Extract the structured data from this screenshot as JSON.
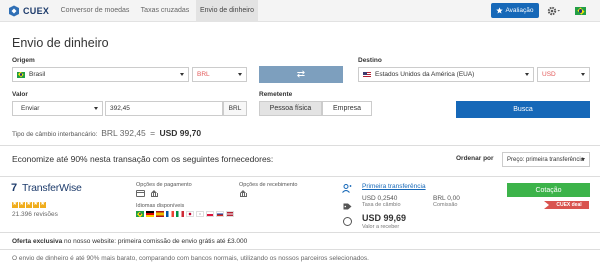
{
  "nav": {
    "brand": "CUEX",
    "tabs": [
      {
        "label": "Conversor de moedas",
        "active": false
      },
      {
        "label": "Taxas cruzadas",
        "active": false
      },
      {
        "label": "Envio de dinheiro",
        "active": true
      }
    ],
    "rating_button": "Avaliação",
    "settings_icon": "gear-icon",
    "language_flag": "flag-br"
  },
  "page_title": "Envio de dinheiro",
  "form": {
    "origin_label": "Origem",
    "origin_country": "Brasil",
    "origin_currency": "BRL",
    "destination_label": "Destino",
    "destination_country": "Estados Unidos da América (EUA)",
    "destination_currency": "USD",
    "swap_icon": "swap-arrows-icon",
    "value_label": "Valor",
    "value_mode": "Enviar",
    "amount": "392,45",
    "amount_currency": "BRL",
    "sender_label": "Remetente",
    "sender_options": [
      "Pessoa física",
      "Empresa"
    ],
    "sender_selected": "Pessoa física",
    "search_button": "Busca"
  },
  "interbank": {
    "label": "Tipo de câmbio interbancário:",
    "from": "BRL 392,45",
    "eq": " = ",
    "to": "USD 99,70"
  },
  "results": {
    "headline": "Economize até 90% nesta transação com os seguintes fornecedores:",
    "sort_label": "Ordenar por",
    "sort_value": "Preço: primeira transferência"
  },
  "provider": {
    "name": "TransferWise",
    "rating_stars": 5,
    "reviews": "21.396 revisões",
    "payment_label": "Opções de pagamento",
    "receive_label": "Opções de recebimento",
    "languages_label": "Idiomas disponíveis",
    "transfer_link": "Primeira transferência",
    "rate_value": "USD 0,2540",
    "rate_label": "Taxa de câmbio",
    "fee_value": "BRL 0,00",
    "fee_label": "Comissão",
    "receive_amount": "USD 99,69",
    "receive_amount_label": "Valor a receber",
    "quote_button": "Cotação",
    "badge": "CUEX deal"
  },
  "offer": {
    "bold": "Oferta exclusiva",
    "text": " no nosso website: primeira comissão de envio grátis até £3.000"
  },
  "footer": "O envio de dinheiro é até 90% mais barato, comparando com bancos normais, utilizando os nossos parceiros selecionados.",
  "colors": {
    "primary": "#1668b8",
    "swap": "#7d9fbe",
    "quote": "#3cb34a",
    "badge": "#d9534f",
    "currency": "#e35a5a"
  }
}
